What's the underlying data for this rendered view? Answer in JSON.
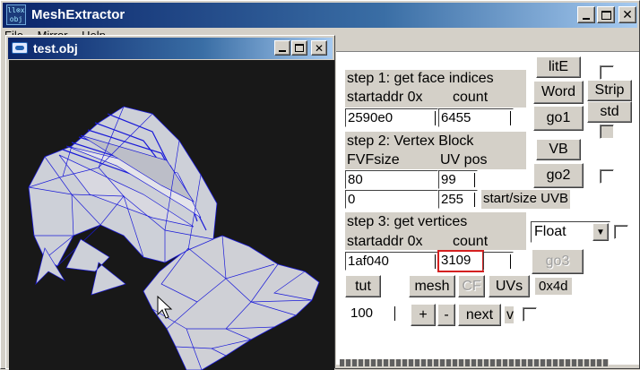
{
  "app": {
    "title": "MeshExtractor",
    "icon_text": [
      "ll⊗x",
      "obj"
    ],
    "menu_items": [
      "File",
      "Mirror",
      "Help"
    ]
  },
  "child_window": {
    "title": "test.obj"
  },
  "step1": {
    "heading": "step 1: get face indices",
    "sub_left": "startaddr 0x",
    "sub_right": "count",
    "startaddr": "2590e0",
    "count": "6455"
  },
  "step2": {
    "heading": "step 2: Vertex Block",
    "sub_left": "FVFsize",
    "sub_right": "UV pos",
    "fvfsize": "80",
    "uvpos": "99",
    "start": "0",
    "size": "255",
    "uvb_label": "start/size UVB"
  },
  "step3": {
    "heading": "step 3: get vertices",
    "sub_left": "startaddr 0x",
    "sub_right": "count",
    "startaddr": "1af040",
    "count": "3109"
  },
  "buttons": {
    "lite": "litE",
    "word": "Word",
    "strip": "Strip",
    "std": "std",
    "go1": "go1",
    "vb": "VB",
    "go2": "go2",
    "go3": "go3",
    "tut": "tut",
    "mesh": "mesh",
    "cf": "CF",
    "uvs": "UVs",
    "plus": "+",
    "minus": "-",
    "next": "next",
    "v": "v"
  },
  "format_select": "Float",
  "hex_label": "0x4d",
  "step_value": "100",
  "colors": {
    "title_active": "#0a246a",
    "title_gradient_end": "#a6caf0",
    "face": "#d2d2d6",
    "wire": "#1010d8",
    "viewport_bg": "#181818",
    "highlight": "#d42020"
  }
}
